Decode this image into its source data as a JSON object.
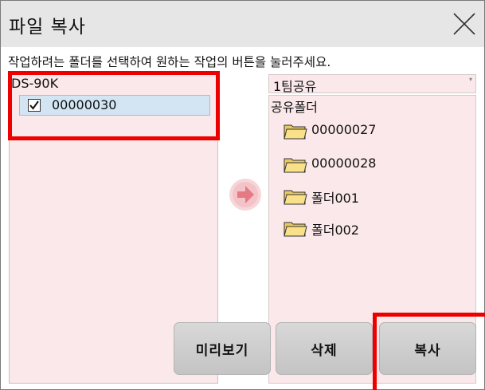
{
  "dialog": {
    "title": "파일 복사",
    "instruction": "작업하려는 폴더를 선택하여 원하는 작업의 버튼을 눌러주세요."
  },
  "source": {
    "device": "DS-90K",
    "items": [
      {
        "label": "00000030",
        "checked": true
      }
    ]
  },
  "destination": {
    "selected_group": "1팀공유",
    "root": "공유폴더",
    "folders": [
      {
        "label": "00000027"
      },
      {
        "label": "00000028"
      },
      {
        "label": "폴더001"
      },
      {
        "label": "폴더002"
      }
    ]
  },
  "buttons": {
    "preview": "미리보기",
    "delete": "삭제",
    "copy": "복사"
  },
  "colors": {
    "panel_bg": "#fae8ea",
    "highlight": "#ee0000",
    "arrow": "#e58a90",
    "folder": "#f9e089"
  },
  "icons": [
    "close-icon",
    "checkmark-icon",
    "arrow-right-icon",
    "folder-icon"
  ]
}
